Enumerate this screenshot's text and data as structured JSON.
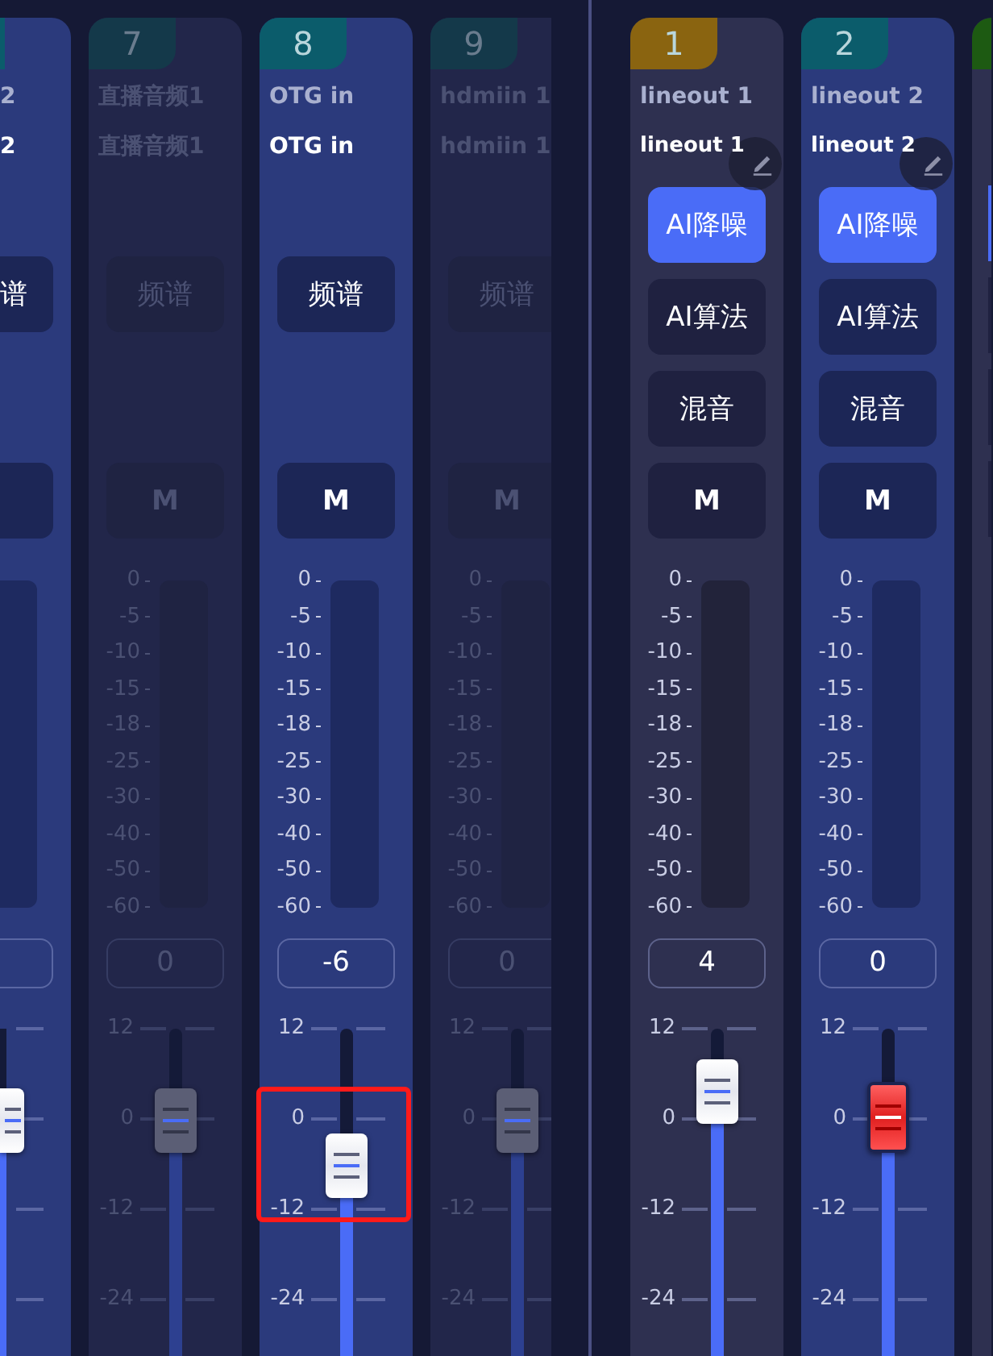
{
  "mixer": {
    "input_channels": [
      {
        "kind": "cut-left",
        "color": "#0b5c6b",
        "selected": true,
        "disabled": false,
        "name": "2",
        "display_name": "2",
        "buttons": [
          {
            "label": "谱",
            "on": false
          }
        ],
        "mute": {
          "on": false
        },
        "level": 0.72,
        "clipping": false
      },
      {
        "kind": "full",
        "number": "7",
        "color": "#14394a",
        "selected": false,
        "disabled": true,
        "name": "直播音频1",
        "display_name": "直播音频1",
        "buttons": [
          {
            "label": "频谱",
            "on": false
          }
        ],
        "mute": {
          "label": "M",
          "on": false
        },
        "meter_scale": [
          "0",
          "-5",
          "-10",
          "-15",
          "-18",
          "-25",
          "-30",
          "-40",
          "-50",
          "-60"
        ],
        "value": "0",
        "fader_scale": [
          "12",
          "0",
          "-12",
          "-24"
        ],
        "level": 0.72,
        "clipping": false,
        "highlighted": false
      },
      {
        "kind": "full",
        "number": "8",
        "color": "#0b5c6b",
        "selected": true,
        "disabled": false,
        "name": "OTG in",
        "display_name": "OTG in",
        "buttons": [
          {
            "label": "频谱",
            "on": false
          }
        ],
        "mute": {
          "label": "M",
          "on": false
        },
        "meter_scale": [
          "0",
          "-5",
          "-10",
          "-15",
          "-18",
          "-25",
          "-30",
          "-40",
          "-50",
          "-60"
        ],
        "value": "-6",
        "fader_scale": [
          "12",
          "0",
          "-12",
          "-24"
        ],
        "level": 0.58,
        "clipping": false,
        "highlighted": true
      },
      {
        "kind": "full",
        "number": "9",
        "color": "#14394a",
        "selected": false,
        "disabled": true,
        "name": "hdmiin 1",
        "display_name": "hdmiin 1",
        "buttons": [
          {
            "label": "频谱",
            "on": false
          }
        ],
        "mute": {
          "label": "M",
          "on": false
        },
        "meter_scale": [
          "0",
          "-5",
          "-10",
          "-15",
          "-18",
          "-25",
          "-30",
          "-40",
          "-50",
          "-60"
        ],
        "value": "0",
        "fader_scale": [
          "12",
          "0",
          "-12",
          "-24"
        ],
        "level": 0.72,
        "clipping": false,
        "highlighted": false
      }
    ],
    "output_channels": [
      {
        "kind": "full",
        "number": "1",
        "color": "#8a6410",
        "selected": false,
        "disabled": false,
        "name": "lineout 1",
        "display_name": "lineout 1",
        "editable": true,
        "buttons": [
          {
            "label": "AI降噪",
            "on": true
          },
          {
            "label": "AI算法",
            "on": false
          },
          {
            "label": "混音",
            "on": false
          }
        ],
        "mute": {
          "label": "M",
          "on": false
        },
        "meter_scale": [
          "0",
          "-5",
          "-10",
          "-15",
          "-18",
          "-25",
          "-30",
          "-40",
          "-50",
          "-60"
        ],
        "value": "4",
        "fader_scale": [
          "12",
          "0",
          "-12",
          "-24"
        ],
        "level": 0.81,
        "clipping": false,
        "highlighted": false
      },
      {
        "kind": "full",
        "number": "2",
        "color": "#0b5c6b",
        "selected": true,
        "disabled": false,
        "name": "lineout 2",
        "display_name": "lineout 2",
        "editable": true,
        "buttons": [
          {
            "label": "AI降噪",
            "on": true
          },
          {
            "label": "AI算法",
            "on": false
          },
          {
            "label": "混音",
            "on": false
          }
        ],
        "mute": {
          "label": "M",
          "on": false
        },
        "meter_scale": [
          "0",
          "-5",
          "-10",
          "-15",
          "-18",
          "-25",
          "-30",
          "-40",
          "-50",
          "-60"
        ],
        "value": "0",
        "fader_scale": [
          "12",
          "0",
          "-12",
          "-24"
        ],
        "level": 0.72,
        "clipping": true,
        "highlighted": false
      },
      {
        "kind": "cut-right",
        "color": "#1d5a12",
        "selected": false,
        "disabled": false,
        "buttons": [
          {
            "on": true
          },
          {
            "on": false
          },
          {
            "on": false
          }
        ],
        "mute": {
          "on": false
        }
      }
    ]
  }
}
